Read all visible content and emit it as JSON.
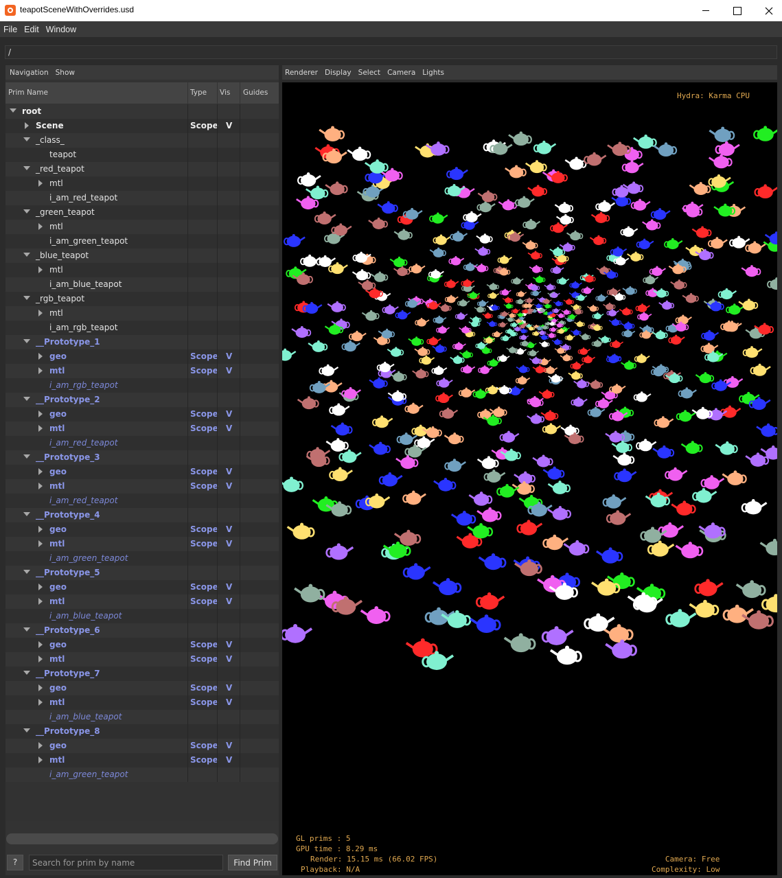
{
  "window": {
    "title": "teapotSceneWithOverrides.usd",
    "controls": [
      "minimize",
      "maximize",
      "close"
    ]
  },
  "menubar": [
    "File",
    "Edit",
    "Window"
  ],
  "path": "/",
  "navigation": {
    "menus": [
      "Navigation",
      "Show"
    ],
    "columns": [
      "Prim Name",
      "Type",
      "Vis",
      "Guides"
    ],
    "rows": [
      {
        "name": "root",
        "depth": 0,
        "expander": "down",
        "style": "bold",
        "type": "",
        "vis": ""
      },
      {
        "name": "Scene",
        "depth": 1,
        "expander": "right",
        "style": "bold",
        "type": "Scope",
        "vis": "V"
      },
      {
        "name": "_class_",
        "depth": 1,
        "expander": "down",
        "style": "normal",
        "type": "",
        "vis": ""
      },
      {
        "name": "teapot",
        "depth": 2,
        "expander": "",
        "style": "normal",
        "type": "",
        "vis": ""
      },
      {
        "name": "_red_teapot",
        "depth": 1,
        "expander": "down",
        "style": "normal",
        "type": "",
        "vis": ""
      },
      {
        "name": "mtl",
        "depth": 2,
        "expander": "right",
        "style": "normal",
        "type": "",
        "vis": ""
      },
      {
        "name": "i_am_red_teapot",
        "depth": 2,
        "expander": "",
        "style": "normal",
        "type": "",
        "vis": ""
      },
      {
        "name": "_green_teapot",
        "depth": 1,
        "expander": "down",
        "style": "normal",
        "type": "",
        "vis": ""
      },
      {
        "name": "mtl",
        "depth": 2,
        "expander": "right",
        "style": "normal",
        "type": "",
        "vis": ""
      },
      {
        "name": "i_am_green_teapot",
        "depth": 2,
        "expander": "",
        "style": "normal",
        "type": "",
        "vis": ""
      },
      {
        "name": "_blue_teapot",
        "depth": 1,
        "expander": "down",
        "style": "normal",
        "type": "",
        "vis": ""
      },
      {
        "name": "mtl",
        "depth": 2,
        "expander": "right",
        "style": "normal",
        "type": "",
        "vis": ""
      },
      {
        "name": "i_am_blue_teapot",
        "depth": 2,
        "expander": "",
        "style": "normal",
        "type": "",
        "vis": ""
      },
      {
        "name": "_rgb_teapot",
        "depth": 1,
        "expander": "down",
        "style": "normal",
        "type": "",
        "vis": ""
      },
      {
        "name": "mtl",
        "depth": 2,
        "expander": "right",
        "style": "normal",
        "type": "",
        "vis": ""
      },
      {
        "name": "i_am_rgb_teapot",
        "depth": 2,
        "expander": "",
        "style": "normal",
        "type": "",
        "vis": ""
      },
      {
        "name": "__Prototype_1",
        "depth": 1,
        "expander": "down",
        "style": "proto",
        "type": "",
        "vis": ""
      },
      {
        "name": "geo",
        "depth": 2,
        "expander": "right",
        "style": "proto",
        "type": "Scope",
        "vis": "V"
      },
      {
        "name": "mtl",
        "depth": 2,
        "expander": "right",
        "style": "proto",
        "type": "Scope",
        "vis": "V"
      },
      {
        "name": "i_am_rgb_teapot",
        "depth": 2,
        "expander": "",
        "style": "inst",
        "type": "",
        "vis": ""
      },
      {
        "name": "__Prototype_2",
        "depth": 1,
        "expander": "down",
        "style": "proto",
        "type": "",
        "vis": ""
      },
      {
        "name": "geo",
        "depth": 2,
        "expander": "right",
        "style": "proto",
        "type": "Scope",
        "vis": "V"
      },
      {
        "name": "mtl",
        "depth": 2,
        "expander": "right",
        "style": "proto",
        "type": "Scope",
        "vis": "V"
      },
      {
        "name": "i_am_red_teapot",
        "depth": 2,
        "expander": "",
        "style": "inst",
        "type": "",
        "vis": ""
      },
      {
        "name": "__Prototype_3",
        "depth": 1,
        "expander": "down",
        "style": "proto",
        "type": "",
        "vis": ""
      },
      {
        "name": "geo",
        "depth": 2,
        "expander": "right",
        "style": "proto",
        "type": "Scope",
        "vis": "V"
      },
      {
        "name": "mtl",
        "depth": 2,
        "expander": "right",
        "style": "proto",
        "type": "Scope",
        "vis": "V"
      },
      {
        "name": "i_am_red_teapot",
        "depth": 2,
        "expander": "",
        "style": "inst",
        "type": "",
        "vis": ""
      },
      {
        "name": "__Prototype_4",
        "depth": 1,
        "expander": "down",
        "style": "proto",
        "type": "",
        "vis": ""
      },
      {
        "name": "geo",
        "depth": 2,
        "expander": "right",
        "style": "proto",
        "type": "Scope",
        "vis": "V"
      },
      {
        "name": "mtl",
        "depth": 2,
        "expander": "right",
        "style": "proto",
        "type": "Scope",
        "vis": "V"
      },
      {
        "name": "i_am_green_teapot",
        "depth": 2,
        "expander": "",
        "style": "inst",
        "type": "",
        "vis": ""
      },
      {
        "name": "__Prototype_5",
        "depth": 1,
        "expander": "down",
        "style": "proto",
        "type": "",
        "vis": ""
      },
      {
        "name": "geo",
        "depth": 2,
        "expander": "right",
        "style": "proto",
        "type": "Scope",
        "vis": "V"
      },
      {
        "name": "mtl",
        "depth": 2,
        "expander": "right",
        "style": "proto",
        "type": "Scope",
        "vis": "V"
      },
      {
        "name": "i_am_blue_teapot",
        "depth": 2,
        "expander": "",
        "style": "inst",
        "type": "",
        "vis": ""
      },
      {
        "name": "__Prototype_6",
        "depth": 1,
        "expander": "down",
        "style": "proto",
        "type": "",
        "vis": ""
      },
      {
        "name": "geo",
        "depth": 2,
        "expander": "right",
        "style": "proto",
        "type": "Scope",
        "vis": "V"
      },
      {
        "name": "mtl",
        "depth": 2,
        "expander": "right",
        "style": "proto",
        "type": "Scope",
        "vis": "V"
      },
      {
        "name": "__Prototype_7",
        "depth": 1,
        "expander": "down",
        "style": "proto",
        "type": "",
        "vis": ""
      },
      {
        "name": "geo",
        "depth": 2,
        "expander": "right",
        "style": "proto",
        "type": "Scope",
        "vis": "V"
      },
      {
        "name": "mtl",
        "depth": 2,
        "expander": "right",
        "style": "proto",
        "type": "Scope",
        "vis": "V"
      },
      {
        "name": "i_am_blue_teapot",
        "depth": 2,
        "expander": "",
        "style": "inst",
        "type": "",
        "vis": ""
      },
      {
        "name": "__Prototype_8",
        "depth": 1,
        "expander": "down",
        "style": "proto",
        "type": "",
        "vis": ""
      },
      {
        "name": "geo",
        "depth": 2,
        "expander": "right",
        "style": "proto",
        "type": "Scope",
        "vis": "V"
      },
      {
        "name": "mtl",
        "depth": 2,
        "expander": "right",
        "style": "proto",
        "type": "Scope",
        "vis": "V"
      },
      {
        "name": "i_am_green_teapot",
        "depth": 2,
        "expander": "",
        "style": "inst",
        "type": "",
        "vis": ""
      }
    ],
    "help_label": "?",
    "search_placeholder": "Search for prim by name",
    "find_label": "Find Prim"
  },
  "viewport": {
    "menus": [
      "Renderer",
      "Display",
      "Select",
      "Camera",
      "Lights"
    ],
    "renderer_label": "Hydra: Karma CPU",
    "stats": {
      "gl_prims": "GL prims : 5",
      "gpu_time": "GPU time : 8.29 ms",
      "render": "Render: 15.15 ms (66.02 FPS)",
      "playback": "Playback: N/A"
    },
    "camera": "Camera: Free",
    "complexity": "Complexity: Low",
    "teapot_colors": [
      "#ff2a2a",
      "#2a35ff",
      "#22ee22",
      "#ffffff",
      "#f060f0",
      "#b070ff",
      "#80f0d0",
      "#ffe070",
      "#ffb080",
      "#90b0a0",
      "#c07070",
      "#70a0c0"
    ]
  },
  "colors": {
    "prototype_text": "#8a96e8",
    "hud_text": "#e0a850"
  }
}
